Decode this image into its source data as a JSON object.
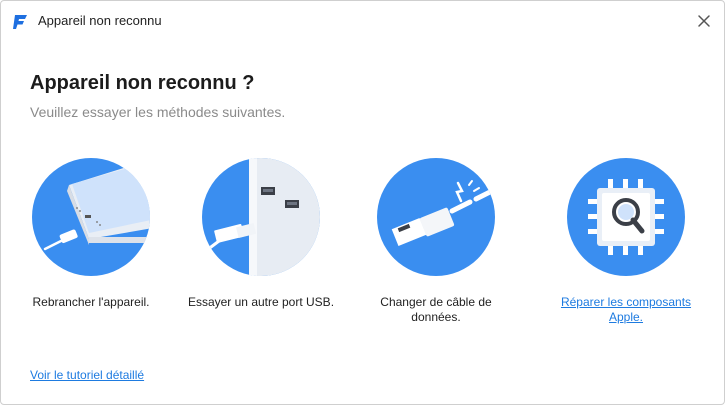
{
  "window": {
    "title": "Appareil non reconnu",
    "logo_icon": "app-logo-icon",
    "close_icon": "close-icon"
  },
  "main": {
    "heading": "Appareil non reconnu ?",
    "subheading": "Veuillez essayer les méthodes suivantes."
  },
  "options": [
    {
      "label": "Rebrancher l'appareil.",
      "icon": "phone-reconnect-icon",
      "is_link": false
    },
    {
      "label": "Essayer un autre port USB.",
      "icon": "usb-port-icon",
      "is_link": false
    },
    {
      "label": "Changer de câble de données.",
      "icon": "usb-cable-icon",
      "is_link": false
    },
    {
      "label": "Réparer les composants Apple.",
      "icon": "chip-repair-icon",
      "is_link": true
    }
  ],
  "footer": {
    "tutorial_link": "Voir le tutoriel détaillé"
  },
  "colors": {
    "accent_blue": "#3a8ef0",
    "link_blue": "#1e7be0",
    "heading": "#1c1c1c",
    "subheading": "#8a8a8a"
  }
}
